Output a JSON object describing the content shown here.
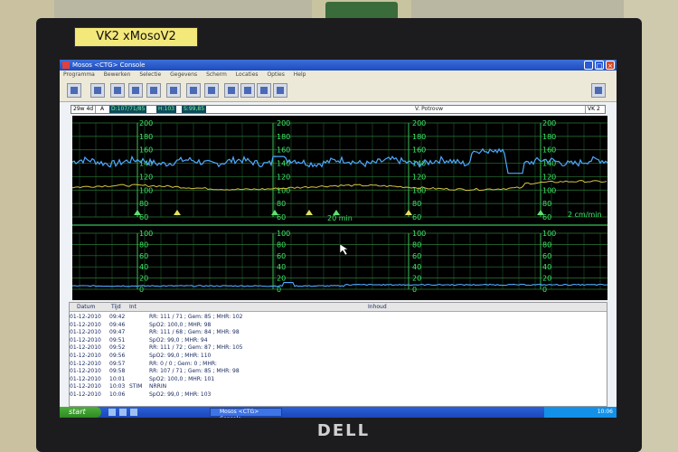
{
  "monitor_label": "VK2  xMosoV2",
  "brand": "DELL",
  "window": {
    "title": "Mosos <CTG> Console",
    "menu": [
      "Programma",
      "Bewerken",
      "Selectie",
      "Gegevens",
      "Scherm",
      "Locaties",
      "Opties",
      "Help"
    ]
  },
  "infobar": {
    "weeks": "29w 4d",
    "marker": "A",
    "d_value": "D:107/71/85",
    "h_value": "H:103",
    "s_value": "S:99,85",
    "patient": "V. Potrovw",
    "vk": "VK 2"
  },
  "chart_data": [
    {
      "type": "line",
      "title": "",
      "y_ticks": [
        60,
        80,
        100,
        120,
        140,
        160,
        180,
        200
      ],
      "ylim": [
        60,
        200
      ],
      "annotations": [
        "20 min",
        "2 cm/min"
      ],
      "series_colors": {
        "heart_rate": "#4fa8ff",
        "secondary": "#d8c340"
      }
    },
    {
      "type": "line",
      "title": "",
      "y_ticks": [
        0,
        20,
        40,
        60,
        80,
        100
      ],
      "ylim": [
        0,
        100
      ],
      "series_colors": {
        "activity": "#4fa8ff"
      }
    }
  ],
  "log": {
    "header": {
      "datum": "Datum",
      "tijd": "Tijd",
      "int": "Int",
      "inhoud": "Inhoud"
    },
    "rows": [
      {
        "datum": "01-12-2010",
        "tijd": "09:42",
        "int": "",
        "text": "RR: 111 / 71 ; Gem: 85 ; MHR: 102"
      },
      {
        "datum": "01-12-2010",
        "tijd": "09:46",
        "int": "",
        "text": "SpO2: 100,0 ; MHR: 98"
      },
      {
        "datum": "01-12-2010",
        "tijd": "09:47",
        "int": "",
        "text": "RR: 111 / 68 ; Gem: 84 ; MHR: 98"
      },
      {
        "datum": "01-12-2010",
        "tijd": "09:51",
        "int": "",
        "text": "SpO2: 99,0 ; MHR: 94"
      },
      {
        "datum": "01-12-2010",
        "tijd": "09:52",
        "int": "",
        "text": "RR: 111 / 72 ; Gem: 87 ; MHR: 105"
      },
      {
        "datum": "01-12-2010",
        "tijd": "09:56",
        "int": "",
        "text": "SpO2: 99,0 ; MHR: 110"
      },
      {
        "datum": "01-12-2010",
        "tijd": "09:57",
        "int": "",
        "text": "RR: 0 / 0 ; Gem: 0 ; MHR:"
      },
      {
        "datum": "01-12-2010",
        "tijd": "09:58",
        "int": "",
        "text": "RR: 107 / 71 ; Gem: 85 ; MHR: 98"
      },
      {
        "datum": "01-12-2010",
        "tijd": "10:01",
        "int": "",
        "text": "SpO2: 100,0 ; MHR: 101"
      },
      {
        "datum": "01-12-2010",
        "tijd": "10:03",
        "int": "STIM",
        "text": "NRRIN"
      },
      {
        "datum": "01-12-2010",
        "tijd": "10:06",
        "int": "",
        "text": "SpO2: 99,0 ; MHR: 103"
      }
    ]
  },
  "taskbar": {
    "start": "start",
    "task": "Mosos <CTG> Console",
    "clock": "10:06"
  }
}
